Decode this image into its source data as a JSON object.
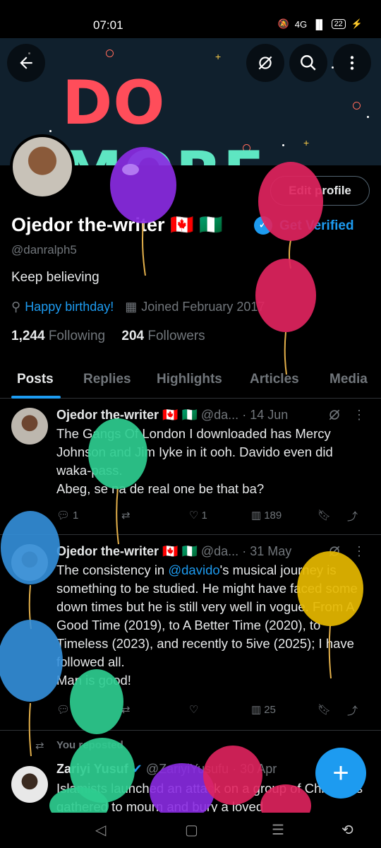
{
  "status": {
    "time": "07:01",
    "network": "4G",
    "signal": "▐▌",
    "battery": "22"
  },
  "banner": {
    "title_do": "DO",
    "title_more": "MORE"
  },
  "profile": {
    "name": "Ojedor the-writer",
    "flags": "🇨🇦 🇳🇬",
    "get_verified": "Get Verified",
    "edit_label": "Edit profile",
    "handle": "@danralph5",
    "bio": "Keep believing",
    "location": "Happy birthday!",
    "joined": "Joined February 2017",
    "following_count": "1,244",
    "following_label": "Following",
    "followers_count": "204",
    "followers_label": "Followers"
  },
  "tabs": [
    {
      "label": "Posts"
    },
    {
      "label": "Replies"
    },
    {
      "label": "Highlights"
    },
    {
      "label": "Articles"
    },
    {
      "label": "Media"
    }
  ],
  "posts": [
    {
      "name": "Ojedor the-writer",
      "flags": "🇨🇦 🇳🇬",
      "handle": "@da...",
      "date": "· 14 Jun",
      "text": "The Gangs Of London I downloaded has Mercy Johnson and Jim Iyke in it ooh. Davido even did waka-pass.\nAbeg, se na de real one be that ba?",
      "replies": "1",
      "likes": "1",
      "views": "189"
    },
    {
      "name": "Ojedor the-writer",
      "flags": "🇨🇦 🇳🇬",
      "handle": "@da...",
      "date": "· 31 May",
      "text_before": "The consistency in ",
      "mention": "@davido",
      "text_after": "'s musical journey is something to be studied. He might have faced some down times but he is still very well in vogue. From A Good Time (2019), to A Better Time (2020), to Timeless (2023), and recently to 5ive (2025); I have followed all.\nMan is good!",
      "replies": "",
      "likes": "",
      "views": "25"
    },
    {
      "repost_label": "You reposted",
      "name": "Zariyi Yusuf",
      "handle": "@ZariyiYusufu",
      "date": "· 30 Apr",
      "text": "Islamists launched an attack on a group of Christians gathered to mourn and bury a loved"
    }
  ],
  "colors": {
    "accent": "#1d9bf0",
    "banner_do": "#ff4d5a",
    "banner_more": "#5ee6c2"
  }
}
